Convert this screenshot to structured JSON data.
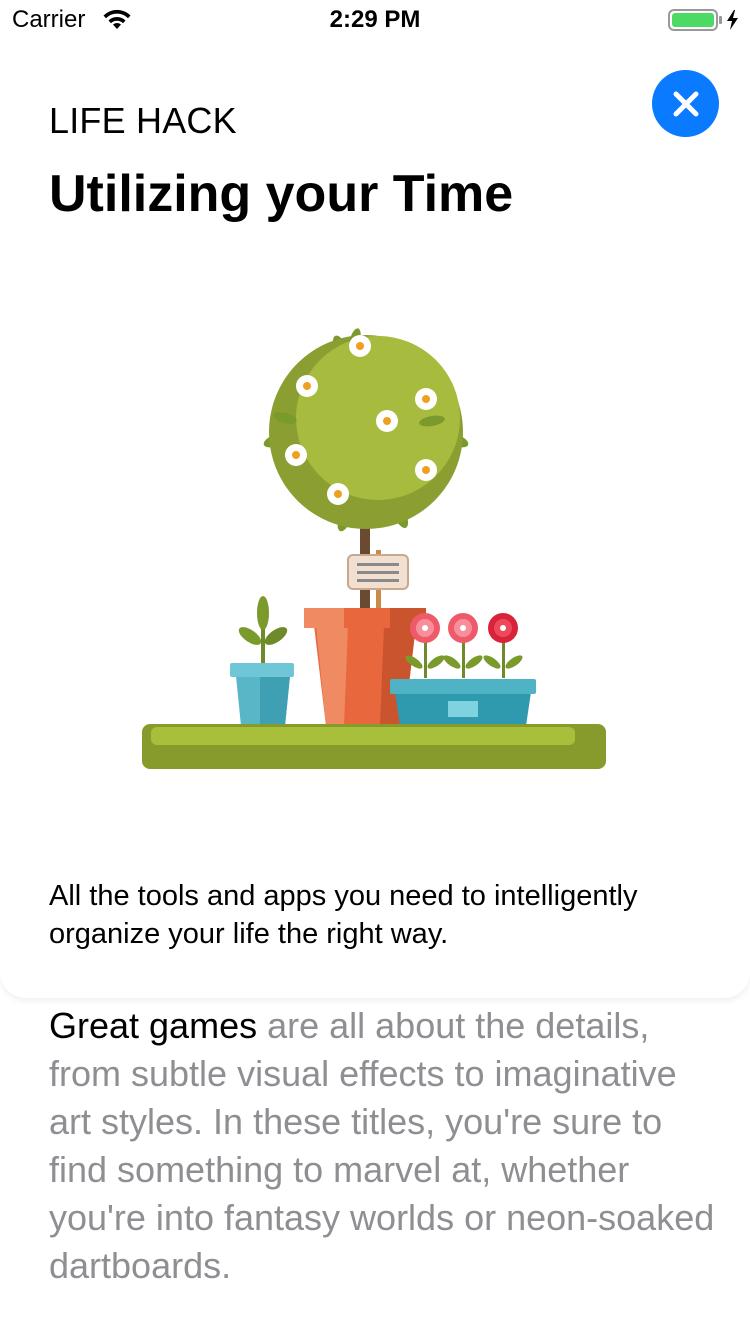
{
  "status_bar": {
    "carrier": "Carrier",
    "time": "2:29 PM"
  },
  "card": {
    "category": "LIFE HACK",
    "title": "Utilizing your Time",
    "subtitle": "All the tools and apps you need to intelligently organize your life the right way."
  },
  "article": {
    "lead": "Great games",
    "body": " are all about the details, from subtle visual effects to imaginative art styles. In these titles, you're sure to find something to marvel at, whether you're into fantasy worlds or neon-soaked dartboards."
  },
  "colors": {
    "accent": "#0a7aff",
    "body_text": "#8e8e93",
    "battery": "#4cd964"
  },
  "icons": {
    "close": "close-icon",
    "wifi": "wifi-icon",
    "battery": "battery-icon",
    "charging": "charging-bolt-icon"
  }
}
